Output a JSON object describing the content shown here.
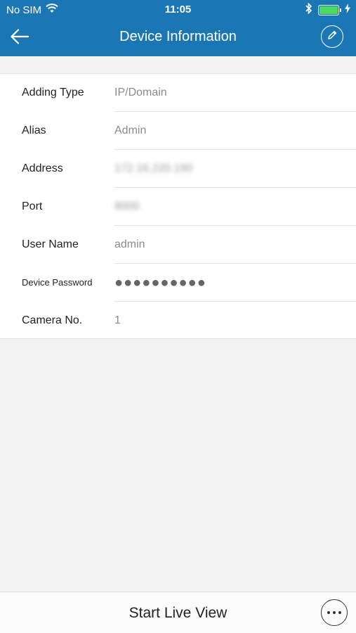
{
  "status_bar": {
    "carrier": "No SIM",
    "time": "11:05",
    "wifi_icon": "wifi-icon",
    "bluetooth_icon": "bluetooth-icon",
    "battery_icon": "battery-charging-icon",
    "battery_color": "#4cd964"
  },
  "nav": {
    "title": "Device Information",
    "back_icon": "back-arrow-icon",
    "edit_icon": "edit-pencil-icon"
  },
  "form": {
    "rows": [
      {
        "label": "Adding Type",
        "value": "IP/Domain"
      },
      {
        "label": "Alias",
        "value": "Admin"
      },
      {
        "label": "Address",
        "value": "172.16.220.190"
      },
      {
        "label": "Port",
        "value": "8000"
      },
      {
        "label": "User Name",
        "value": "admin"
      },
      {
        "label": "Device Password",
        "value": "●●●●●●●●●●"
      },
      {
        "label": "Camera No.",
        "value": "1"
      }
    ]
  },
  "bottom": {
    "live_view_label": "Start Live View",
    "more_icon": "more-options-icon"
  },
  "colors": {
    "header_bg": "#1b77b4",
    "page_bg": "#f3f3f3"
  }
}
